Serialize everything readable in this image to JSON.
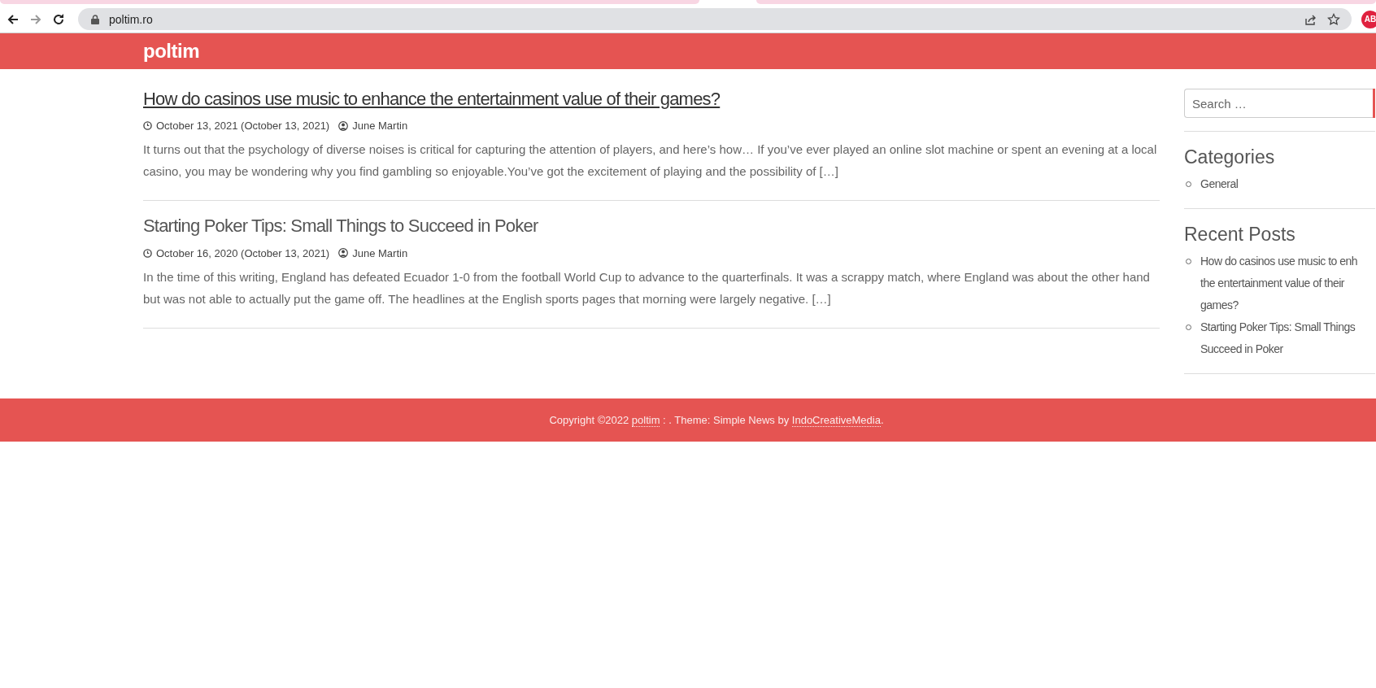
{
  "browser": {
    "url": "poltim.ro",
    "extension_badge": "AB"
  },
  "site": {
    "title": "poltim"
  },
  "posts": [
    {
      "title": "How do casinos use music to enhance the entertainment value of their games?",
      "hovered": true,
      "date": "October 13, 2021 (October 13, 2021)",
      "author": "June Martin",
      "excerpt": "It turns out that the psychology of diverse noises is critical for capturing the attention of players, and here’s how… If you’ve ever played an online slot machine or spent an evening at a local casino, you may be wondering why you find gambling so enjoyable.You’ve got the excitement of playing and the possibility of […]"
    },
    {
      "title": "Starting Poker Tips: Small Things to Succeed in Poker",
      "hovered": false,
      "date": "October 16, 2020 (October 13, 2021)",
      "author": "June Martin",
      "excerpt": "In the time of this writing, England has defeated Ecuador 1-0 from the football World Cup to advance to the quarterfinals. It was a scrappy match, where England was about the other hand but was not able to actually put the game off. The headlines at the English sports pages that morning were largely negative. […]"
    }
  ],
  "sidebar": {
    "search": {
      "placeholder": "Search …"
    },
    "categories": {
      "heading": "Categories",
      "items": [
        "General"
      ]
    },
    "recent_posts": {
      "heading": "Recent Posts",
      "items": [
        {
          "lines": [
            "How do casinos use music to enh",
            "the entertainment value of their",
            "games?"
          ]
        },
        {
          "lines": [
            "Starting Poker Tips: Small Things",
            "Succeed in Poker"
          ]
        }
      ]
    }
  },
  "footer": {
    "prefix": "Copyright ©2022",
    "site_link": "poltim",
    "middle": ": . Theme: Simple News by",
    "theme_link": "IndoCreativeMedia",
    "suffix": "."
  }
}
